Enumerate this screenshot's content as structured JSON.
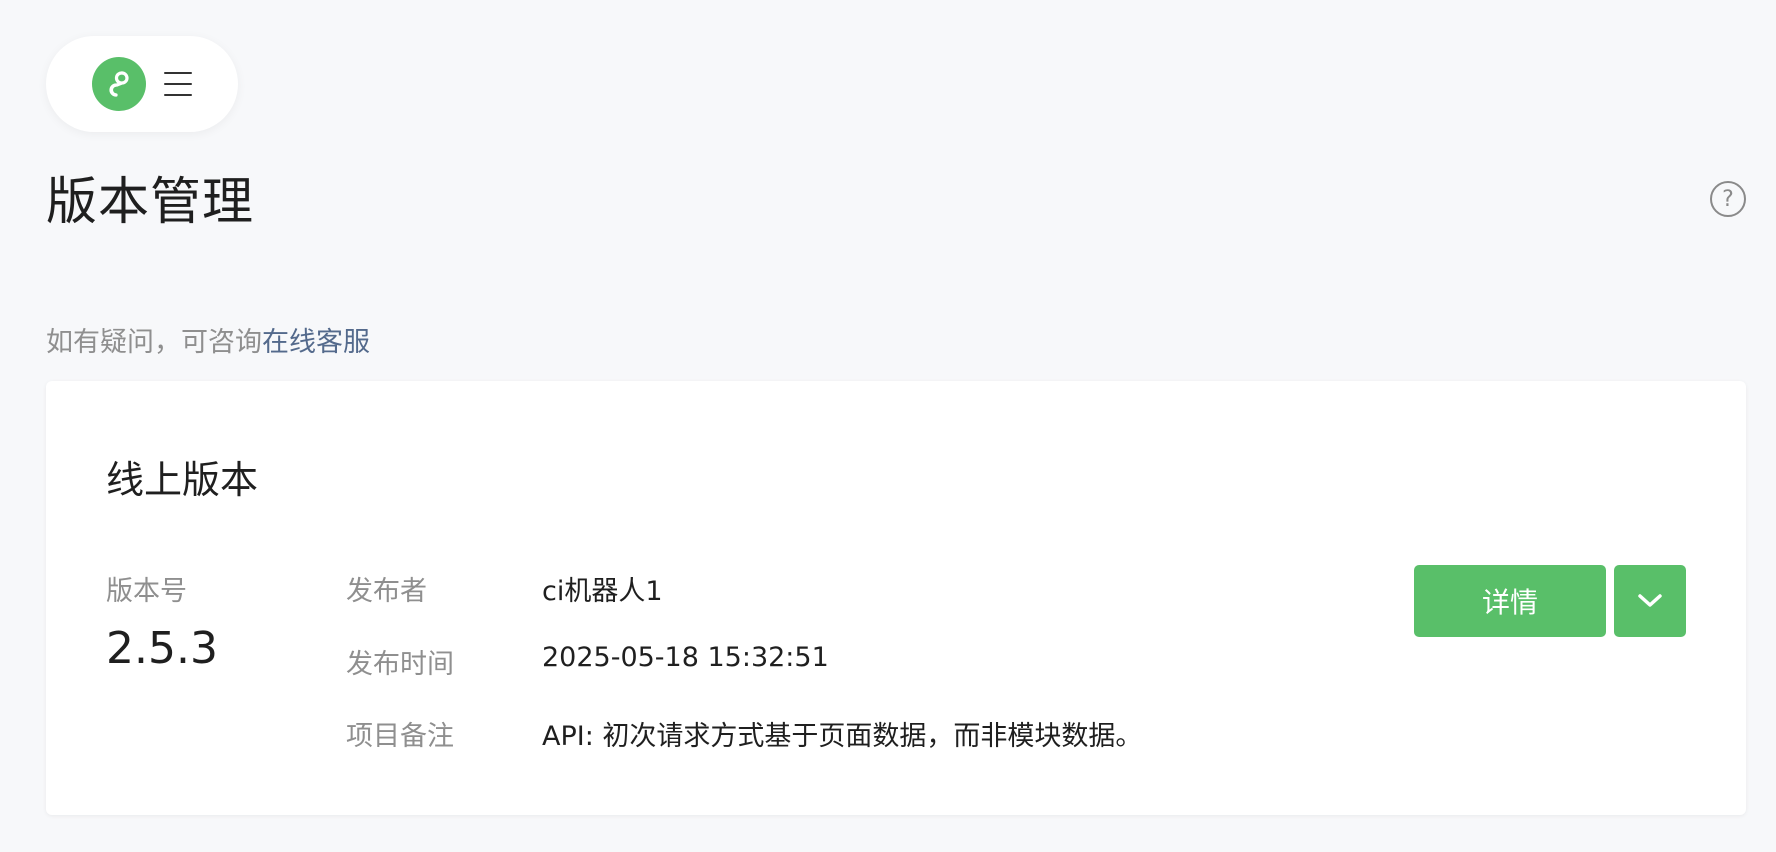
{
  "header": {
    "logo_icon": "link-icon",
    "menu_icon": "hamburger-menu-icon",
    "brand_color": "#59bf69"
  },
  "page": {
    "title": "版本管理",
    "help_icon_glyph": "?"
  },
  "notice": {
    "prefix": "如有疑问，可咨询",
    "link_text": "在线客服",
    "link_color": "#546a8c"
  },
  "online_version": {
    "section_title": "线上版本",
    "version_label": "版本号",
    "version_value": "2.5.3",
    "publisher_label": "发布者",
    "publisher_value": "ci机器人1",
    "publish_time_label": "发布时间",
    "publish_time_value": "2025-05-18 15:32:51",
    "note_label": "项目备注",
    "note_value": "API: 初次请求方式基于页面数据，而非模块数据。",
    "detail_button": "详情",
    "more_icon": "chevron-down-icon"
  }
}
